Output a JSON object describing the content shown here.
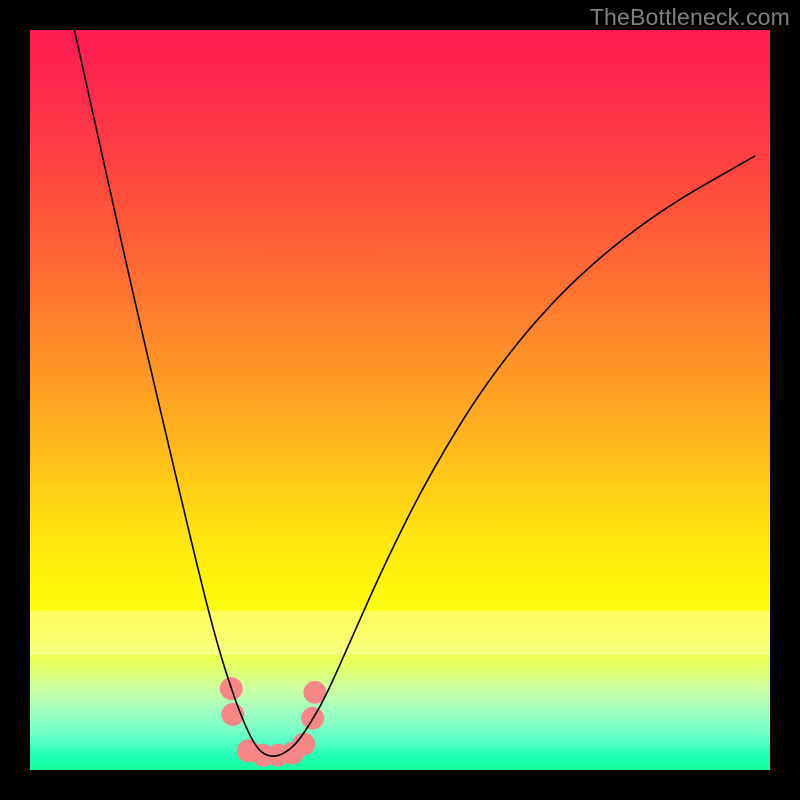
{
  "watermark": "TheBottleneck.com",
  "chart_data": {
    "type": "line",
    "title": "",
    "xlabel": "",
    "ylabel": "",
    "xlim": [
      0,
      100
    ],
    "ylim": [
      0,
      100
    ],
    "grid": false,
    "series": [
      {
        "name": "bottleneck-curve",
        "x": [
          6,
          10,
          14,
          18,
          22,
          25,
          27.5,
          29.5,
          31,
          32.5,
          34,
          36,
          38,
          40,
          44,
          48,
          54,
          62,
          72,
          84,
          98
        ],
        "values": [
          100,
          82,
          64,
          47,
          30,
          18,
          10,
          5,
          2.5,
          1.8,
          2,
          3.5,
          6.5,
          10,
          19,
          28,
          40,
          53,
          65,
          75,
          83
        ]
      }
    ],
    "markers": {
      "name": "trough-markers",
      "color": "#f78787",
      "x": [
        27.2,
        27.4,
        29.5,
        31.5,
        33.5,
        35.5,
        37.0,
        38.2,
        38.5
      ],
      "values": [
        11.0,
        7.5,
        2.6,
        2.0,
        2.0,
        2.3,
        3.5,
        7.0,
        10.5
      ]
    }
  }
}
